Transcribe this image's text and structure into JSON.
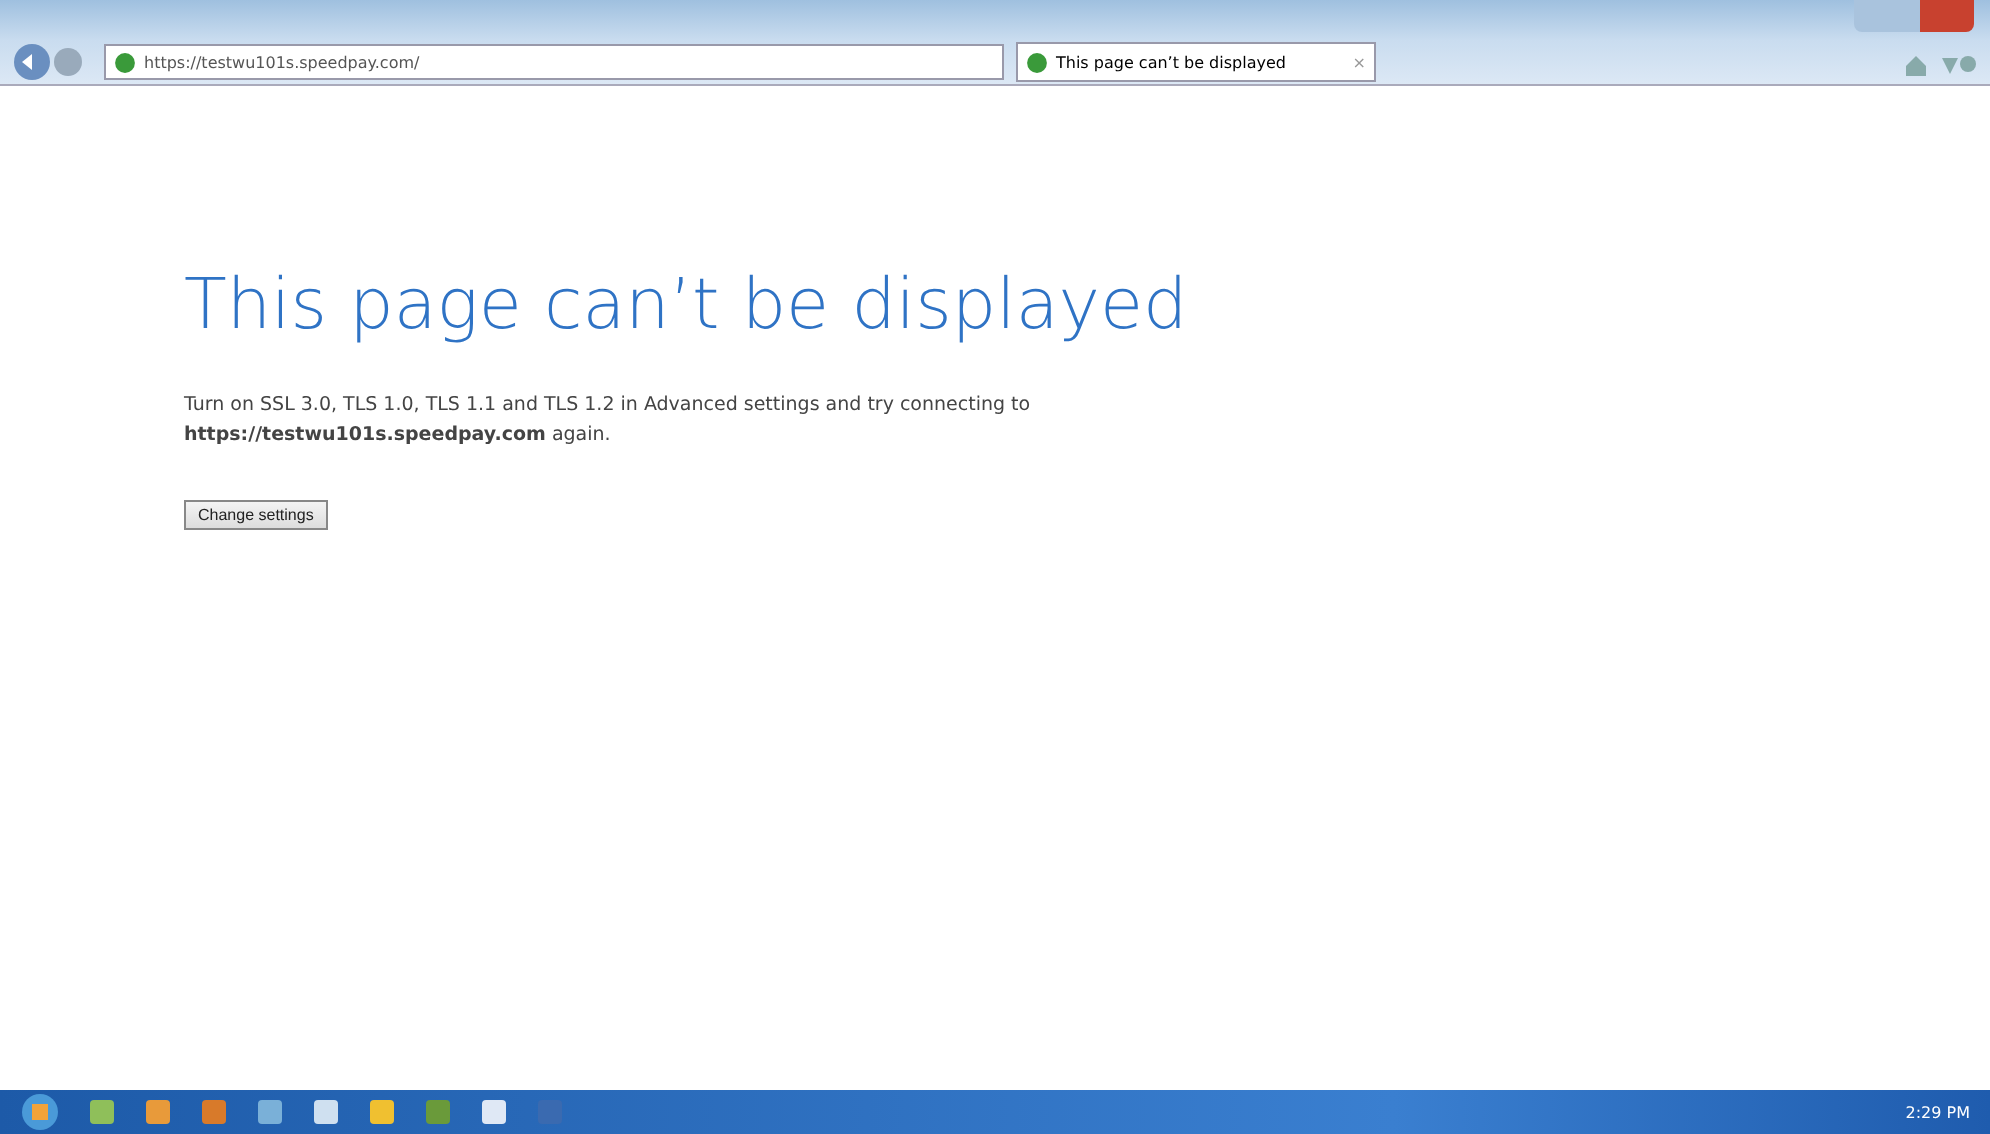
{
  "address_bar": {
    "url": "https://testwu101s.speedpay.com/"
  },
  "tabs": [
    {
      "label": "This page can’t be displayed",
      "close": "×",
      "selected": true
    }
  ],
  "page": {
    "heading": "This page can’t be displayed",
    "message": "Turn on SSL 3.0, TLS 1.0, TLS 1.1 and TLS 1.2 in Advanced settings and try connecting to",
    "host": "https://testwu101s.speedpay.com",
    "tail": "again.",
    "button": "Change settings"
  },
  "taskbar": {
    "clock": "2:29 PM"
  }
}
